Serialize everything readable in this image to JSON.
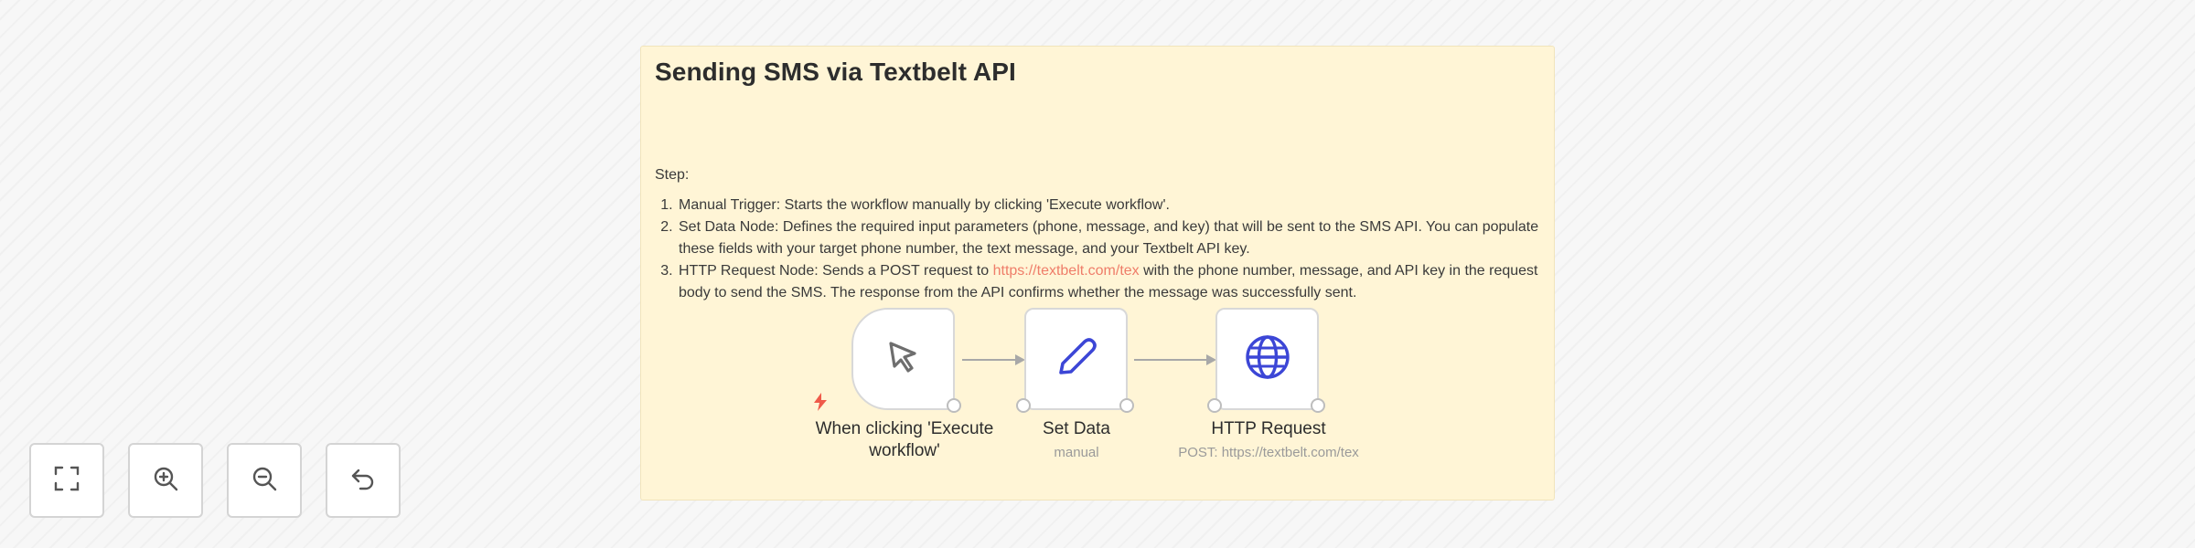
{
  "note": {
    "title": "Sending SMS via Textbelt API",
    "step_label": "Step:",
    "steps": [
      {
        "text": "Manual Trigger: Starts the workflow manually by clicking 'Execute workflow'."
      },
      {
        "text": "Set Data Node: Defines the required input parameters (phone, message, and key) that will be sent to the SMS API. You can populate these fields with your target phone number, the text message, and your Textbelt API key."
      },
      {
        "before": "HTTP Request Node: Sends a POST request to ",
        "link": "https://textbelt.com/tex",
        "after": " with the phone number, message, and API key in the request body to send the SMS. The response from the API confirms whether the message was successfully sent."
      }
    ]
  },
  "nodes": [
    {
      "id": "trigger",
      "icon": "cursor-icon",
      "label_line1": "When clicking 'Execute",
      "label_line2": "workflow'"
    },
    {
      "id": "set",
      "icon": "pencil-icon",
      "label": "Set Data",
      "subtitle": "manual"
    },
    {
      "id": "http",
      "icon": "globe-icon",
      "label": "HTTP Request",
      "subtitle": "POST: https://textbelt.com/tex"
    }
  ],
  "colors": {
    "note_background": "#fff5d6",
    "trigger_bolt": "#ef5a4a",
    "icon_blue": "#3c46d6",
    "link": "#ef7d69"
  },
  "controls": [
    {
      "name": "fit-view",
      "icon": "fullscreen-icon"
    },
    {
      "name": "zoom-in",
      "icon": "zoom-in-icon"
    },
    {
      "name": "zoom-out",
      "icon": "zoom-out-icon"
    },
    {
      "name": "reset-zoom",
      "icon": "undo-icon"
    }
  ]
}
